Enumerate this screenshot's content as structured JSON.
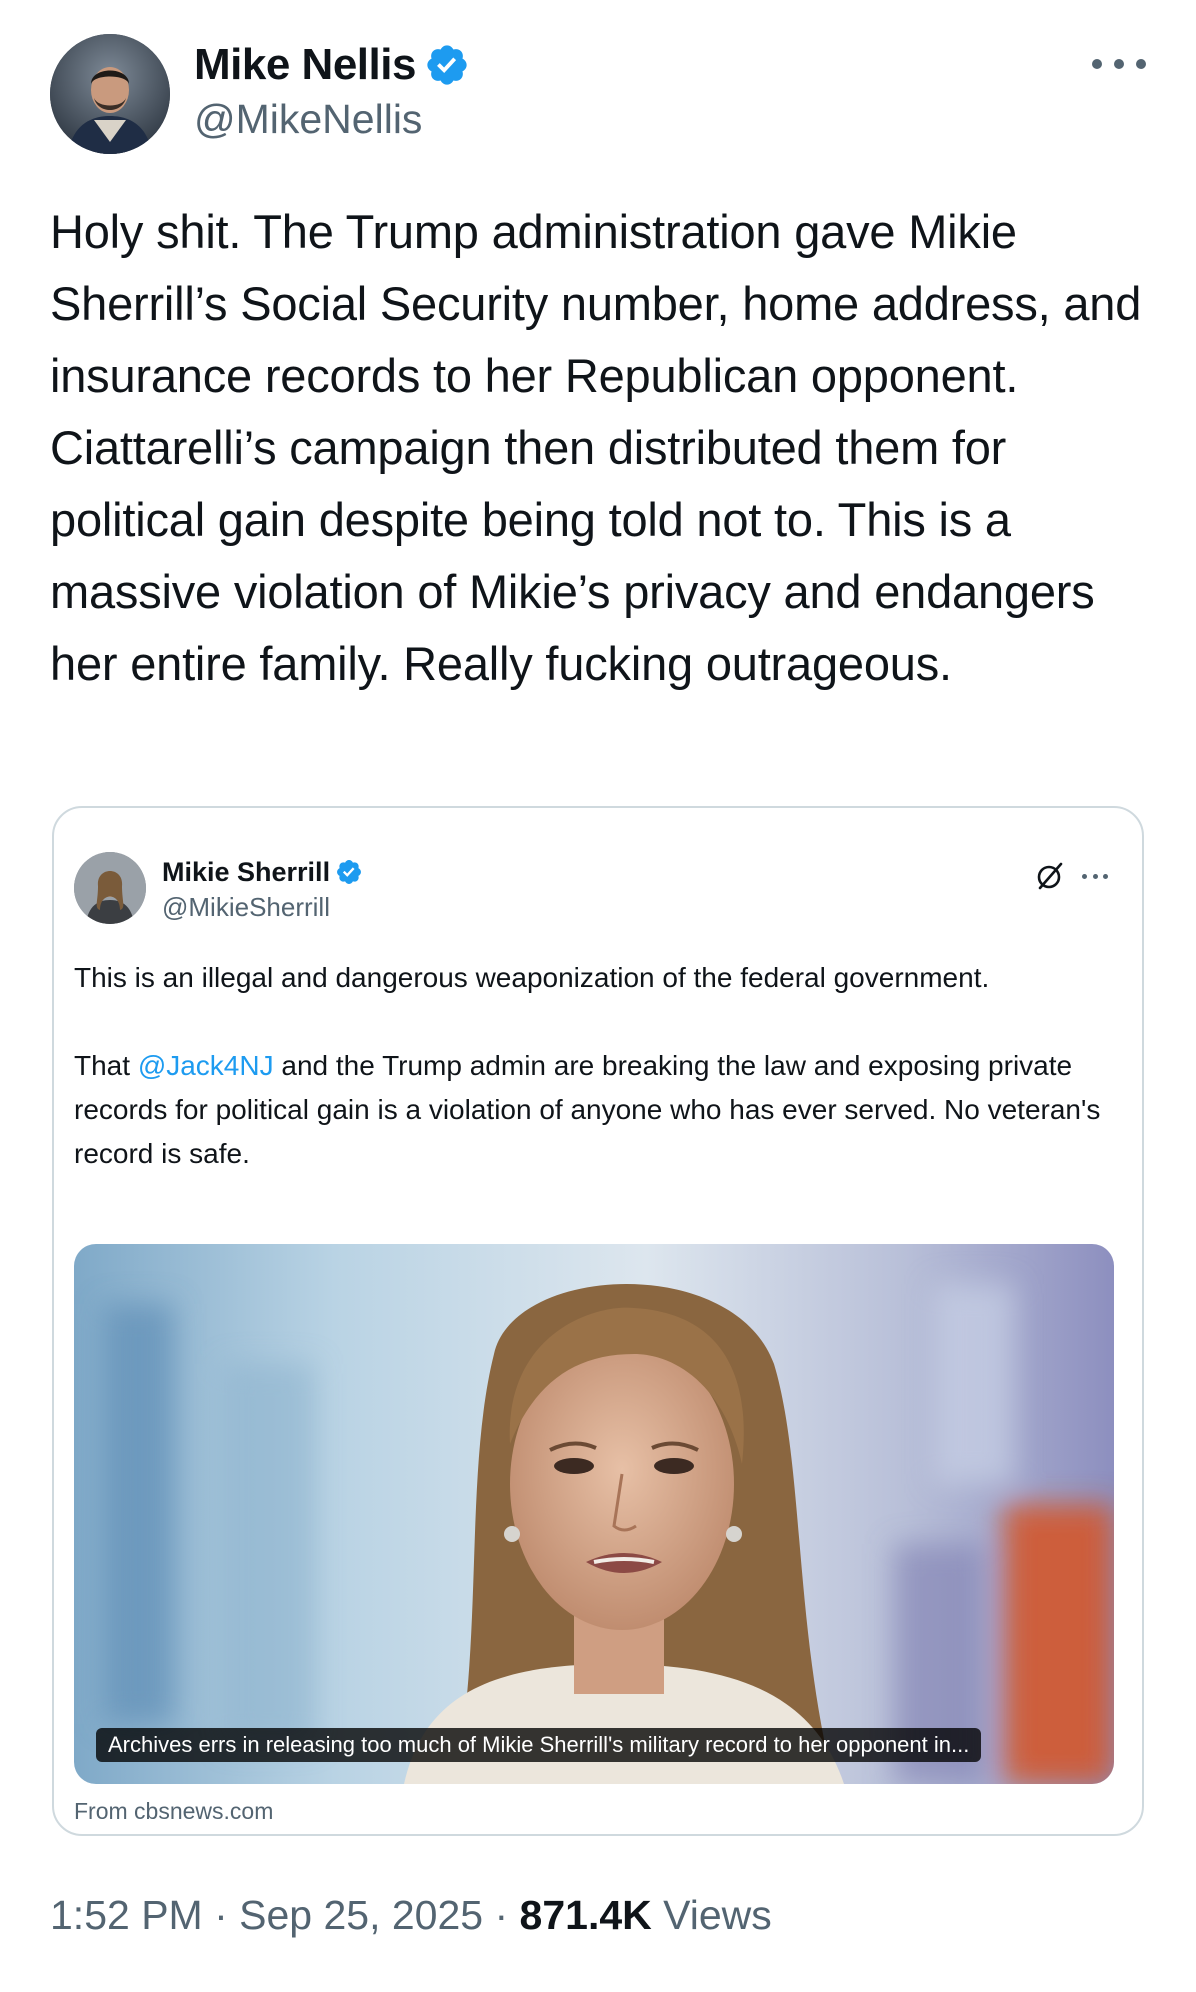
{
  "author": {
    "name": "Mike Nellis",
    "handle": "@MikeNellis",
    "verified": true,
    "verified_color": "#1d9bf0"
  },
  "tweet": {
    "text": "Holy shit. The Trump administration gave Mikie Sherrill’s Social Security number, home address, and insurance records to her Republican opponent. Ciattarelli’s campaign then distributed them for political gain despite being told not to. This is a massive violation of Mikie’s privacy and endangers her entire family. Really fucking outrageous."
  },
  "quote": {
    "author_name": "Mikie Sherrill",
    "author_handle": "@MikieSherrill",
    "verified": true,
    "paragraph1": "This is an illegal and dangerous weaponization of the federal government.",
    "paragraph2_prefix": "That ",
    "paragraph2_mention": "@Jack4NJ",
    "paragraph2_suffix": " and the Trump admin are breaking the law and exposing private records for political gain is a violation of anyone who has ever served. No veteran's record is safe.",
    "link_caption": "Archives errs in releasing too much of Mikie Sherrill's military record to her opponent in...",
    "link_source": "From cbsnews.com"
  },
  "footer": {
    "time": "1:52 PM",
    "separator": " · ",
    "date": "Sep 25, 2025",
    "views_count": "871.4K",
    "views_label": " Views"
  },
  "icons": {
    "more": "more-dots-icon",
    "verified": "verified-badge-icon",
    "grok": "grok-icon"
  },
  "colors": {
    "text_primary": "#0f1419",
    "text_secondary": "#536471",
    "accent": "#1d9bf0",
    "border": "#cfd9de"
  }
}
